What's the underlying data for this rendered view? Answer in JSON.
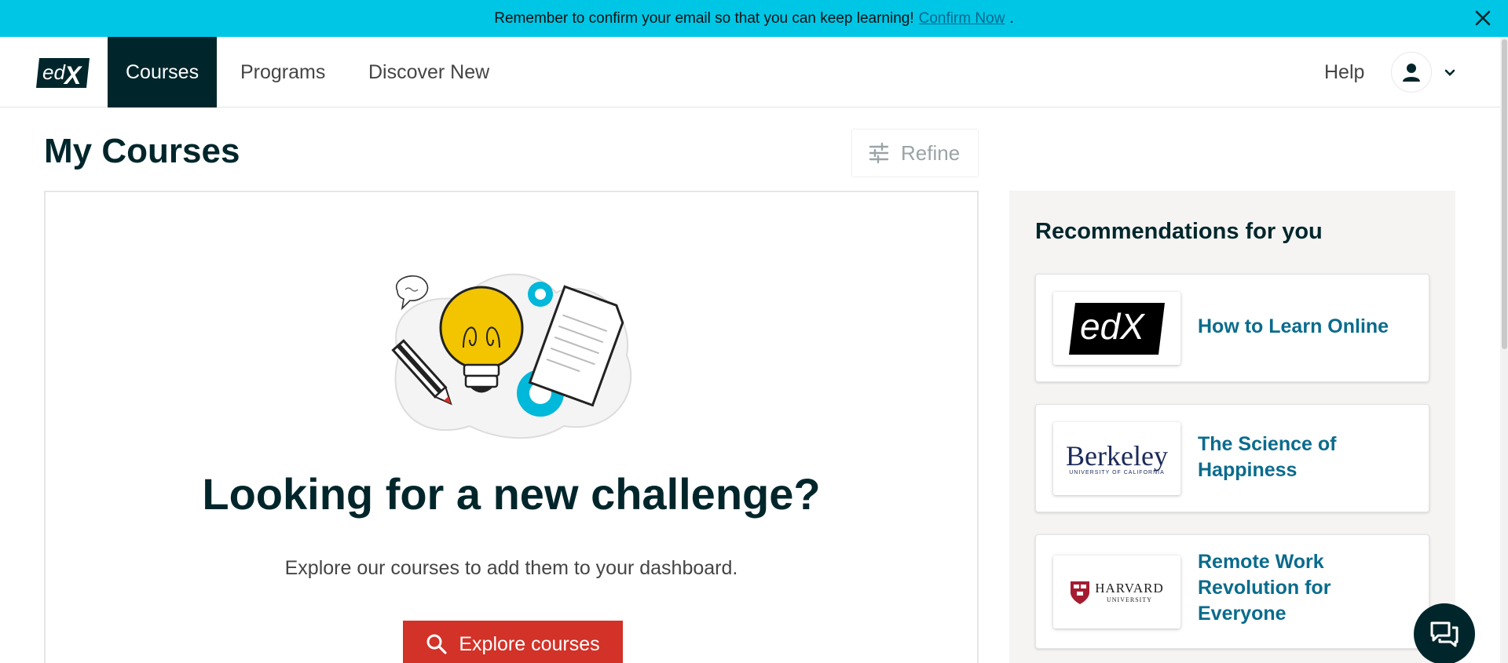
{
  "banner": {
    "message": "Remember to confirm your email so that you can keep learning!",
    "link_label": "Confirm Now",
    "trailing": "."
  },
  "header": {
    "logo_text": "edX",
    "nav": [
      {
        "label": "Courses",
        "active": true
      },
      {
        "label": "Programs",
        "active": false
      },
      {
        "label": "Discover New",
        "active": false
      }
    ],
    "help_label": "Help"
  },
  "main": {
    "title": "My Courses",
    "refine_label": "Refine",
    "empty_state": {
      "heading": "Looking for a new challenge?",
      "text": "Explore our courses to add them to your dashboard.",
      "button_label": "Explore courses"
    }
  },
  "recommendations": {
    "title": "Recommendations for you",
    "items": [
      {
        "name": "How to Learn Online",
        "logo": "edX"
      },
      {
        "name": "The Science of Happiness",
        "logo": "Berkeley",
        "logo_sub": "UNIVERSITY OF CALIFORNIA"
      },
      {
        "name": "Remote Work Revolution for Everyone",
        "logo": "HARVARD",
        "logo_sub": "UNIVERSITY"
      }
    ]
  },
  "colors": {
    "banner_bg": "#00c6e6",
    "nav_active_bg": "#00262b",
    "primary_button": "#d23228",
    "link": "#0a6b8c",
    "sidebar_bg": "#f5f4f2"
  },
  "icons": [
    "close-icon",
    "user-icon",
    "chevron-down-icon",
    "sliders-icon",
    "search-icon",
    "chat-icon"
  ]
}
